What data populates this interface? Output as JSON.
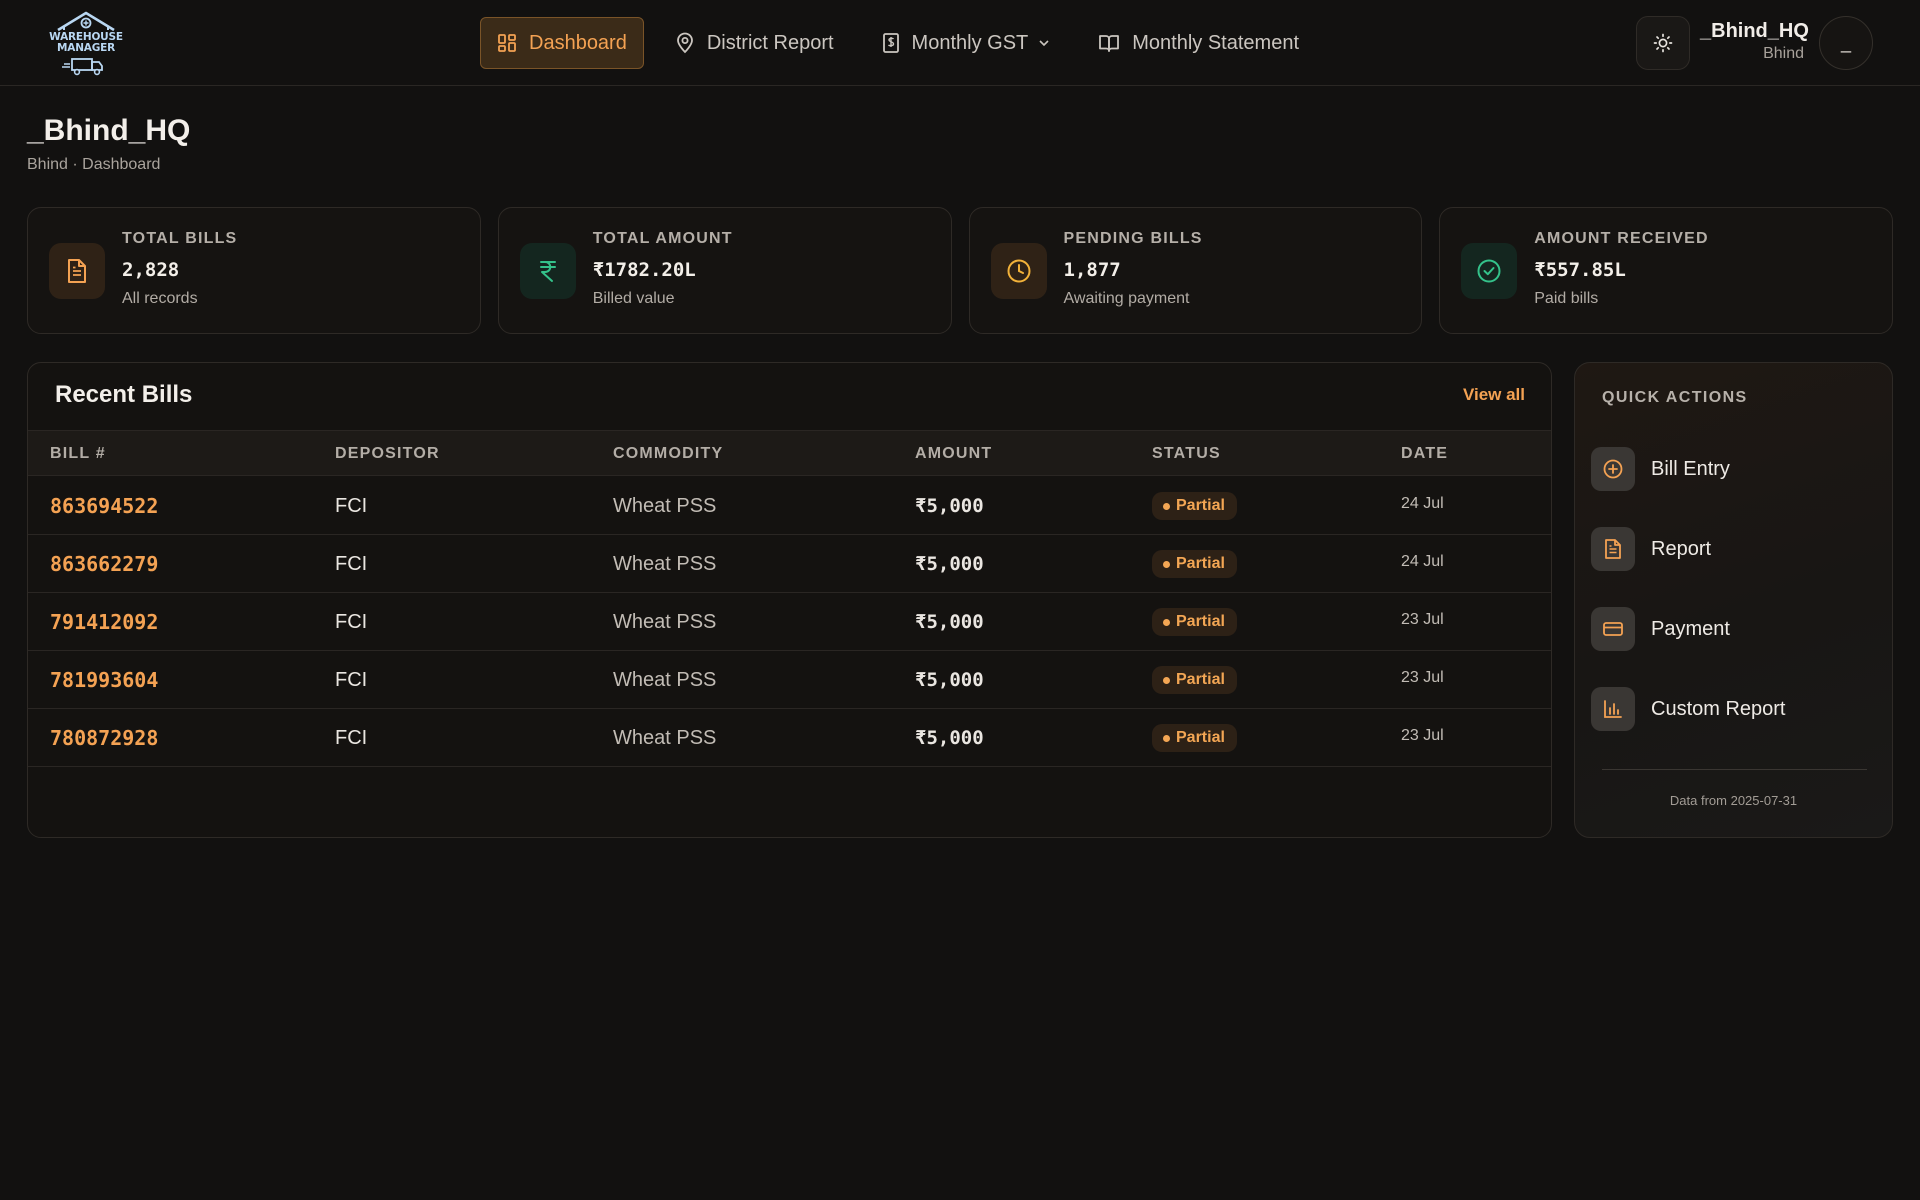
{
  "app": {
    "logo_text_line1": "WAREHOUSE",
    "logo_text_line2": "MANAGER"
  },
  "nav": {
    "items": [
      {
        "label": "Dashboard",
        "icon": "dashboard-icon",
        "active": true
      },
      {
        "label": "District Report",
        "icon": "map-pin-icon",
        "active": false
      },
      {
        "label": "Monthly GST",
        "icon": "receipt-icon",
        "active": false,
        "dropdown": true
      },
      {
        "label": "Monthly Statement",
        "icon": "book-icon",
        "active": false
      }
    ]
  },
  "user": {
    "name": "_Bhind_HQ",
    "location": "Bhind",
    "avatar_initial": "_"
  },
  "page": {
    "title": "_Bhind_HQ",
    "breadcrumb": "Bhind · Dashboard"
  },
  "stats": [
    {
      "label": "TOTAL BILLS",
      "value": "2,828",
      "sub": "All records",
      "icon": "document-icon",
      "accent": "#f4a253"
    },
    {
      "label": "TOTAL AMOUNT",
      "value": "₹1782.20L",
      "sub": "Billed value",
      "icon": "rupee-icon",
      "accent": "#34c28a"
    },
    {
      "label": "PENDING BILLS",
      "value": "1,877",
      "sub": "Awaiting payment",
      "icon": "clock-icon",
      "accent": "#f2b23a"
    },
    {
      "label": "AMOUNT RECEIVED",
      "value": "₹557.85L",
      "sub": "Paid bills",
      "icon": "check-circle-icon",
      "accent": "#34c28a"
    }
  ],
  "recent_bills": {
    "title": "Recent Bills",
    "view_all": "View all",
    "columns": [
      "BILL #",
      "DEPOSITOR",
      "COMMODITY",
      "AMOUNT",
      "STATUS",
      "DATE"
    ],
    "rows": [
      {
        "bill": "863694522",
        "depositor": "FCI",
        "commodity": "Wheat PSS",
        "amount": "₹5,000",
        "status": "Partial",
        "date": "24 Jul"
      },
      {
        "bill": "863662279",
        "depositor": "FCI",
        "commodity": "Wheat PSS",
        "amount": "₹5,000",
        "status": "Partial",
        "date": "24 Jul"
      },
      {
        "bill": "791412092",
        "depositor": "FCI",
        "commodity": "Wheat PSS",
        "amount": "₹5,000",
        "status": "Partial",
        "date": "23 Jul"
      },
      {
        "bill": "781993604",
        "depositor": "FCI",
        "commodity": "Wheat PSS",
        "amount": "₹5,000",
        "status": "Partial",
        "date": "23 Jul"
      },
      {
        "bill": "780872928",
        "depositor": "FCI",
        "commodity": "Wheat PSS",
        "amount": "₹5,000",
        "status": "Partial",
        "date": "23 Jul"
      }
    ]
  },
  "quick_actions": {
    "title": "QUICK ACTIONS",
    "items": [
      {
        "label": "Bill Entry",
        "icon": "plus-circle-icon"
      },
      {
        "label": "Report",
        "icon": "document-icon"
      },
      {
        "label": "Payment",
        "icon": "credit-card-icon"
      },
      {
        "label": "Custom Report",
        "icon": "bar-chart-icon"
      }
    ],
    "footer": "Data from 2025-07-31"
  },
  "colors": {
    "background": "#121110",
    "accent": "#f4a253",
    "green": "#34c28a"
  }
}
